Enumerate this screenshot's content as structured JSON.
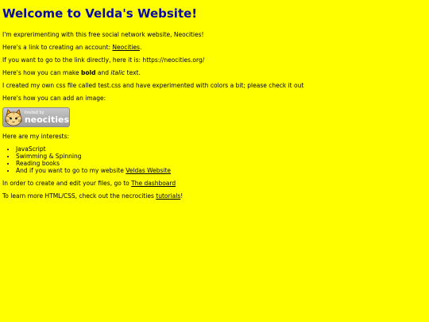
{
  "page": {
    "title": "Welcome to Velda's Website!",
    "intro": "I'm exprerimenting with this free social network website, Neocities!",
    "link_line": {
      "before": "Here's a link to creating an account: ",
      "link_text": "Neocities",
      "after": "."
    },
    "direct_line": "If you want to go to the link directly, here it is: https://neocities.org/",
    "format_line": {
      "before": "Here's how you can make ",
      "bold": "bold",
      "middle": " and ",
      "italic": "italic",
      "after": " text."
    },
    "css_line": "I created my own css file called test.css and have experimented with colors a bit; please check it out",
    "image_line": "Here's how you can add an image:",
    "badge": {
      "small_text": "hosted by",
      "big_text": "neocities"
    },
    "interests_heading": "Here are my interests:",
    "interests": [
      "JavaScript",
      "Swimming & Spinning",
      "Reading books",
      "And if you want to go to my website "
    ],
    "website_link": "Veldas Website",
    "dashboard_line": {
      "before": "In order to create and edit your files, go to ",
      "link_text": "The dashboard"
    },
    "learn_line": {
      "before": "To learn more HTML/CSS, check out the necrocities ",
      "link_text": "tutorials",
      "after": "!"
    }
  },
  "colors": {
    "background": "#ffff00",
    "heading": "#0b0ba0",
    "text": "#000000"
  }
}
